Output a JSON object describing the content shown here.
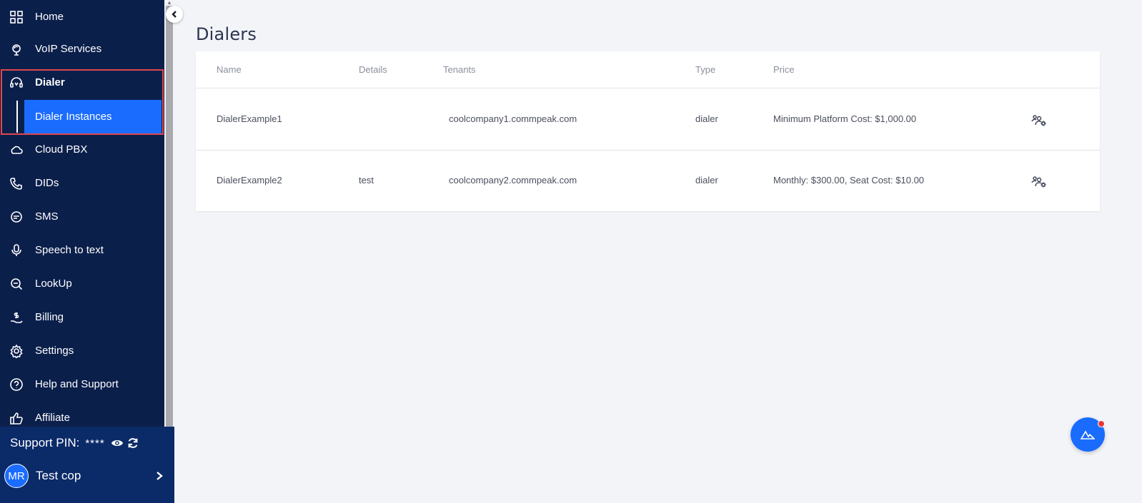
{
  "sidebar": {
    "items": [
      {
        "label": "Home",
        "icon": "grid-icon"
      },
      {
        "label": "VoIP Services",
        "icon": "globe-icon"
      },
      {
        "label": "Dialer",
        "icon": "headset-icon"
      },
      {
        "label": "Cloud PBX",
        "icon": "cloud-icon"
      },
      {
        "label": "DIDs",
        "icon": "phone-icon"
      },
      {
        "label": "SMS",
        "icon": "message-icon"
      },
      {
        "label": "Speech to text",
        "icon": "microphone-icon"
      },
      {
        "label": "LookUp",
        "icon": "magnifier-icon"
      },
      {
        "label": "Billing",
        "icon": "billing-icon"
      },
      {
        "label": "Settings",
        "icon": "gear-icon"
      },
      {
        "label": "Help and Support",
        "icon": "help-icon"
      },
      {
        "label": "Affiliate",
        "icon": "thumbs-up-icon"
      }
    ],
    "sub_item": "Dialer Instances"
  },
  "support": {
    "label": "Support PIN:",
    "value": "****"
  },
  "user": {
    "initials": "MR",
    "name": "Test cop"
  },
  "main": {
    "title": "Dialers",
    "columns": [
      "Name",
      "Details",
      "Tenants",
      "Type",
      "Price"
    ],
    "rows": [
      {
        "name": "DialerExample1",
        "details": "",
        "tenants": "coolcompany1.commpeak.com",
        "type": "dialer",
        "price": "Minimum Platform Cost: $1,000.00"
      },
      {
        "name": "DialerExample2",
        "details": "test",
        "tenants": "coolcompany2.commpeak.com",
        "type": "dialer",
        "price": "Monthly: $300.00, Seat Cost: $10.00"
      }
    ]
  },
  "colors": {
    "sidebar_bg": "#0b1f4b",
    "accent": "#1a6cff",
    "highlight_border": "#e0474c",
    "notification": "#e53935"
  }
}
